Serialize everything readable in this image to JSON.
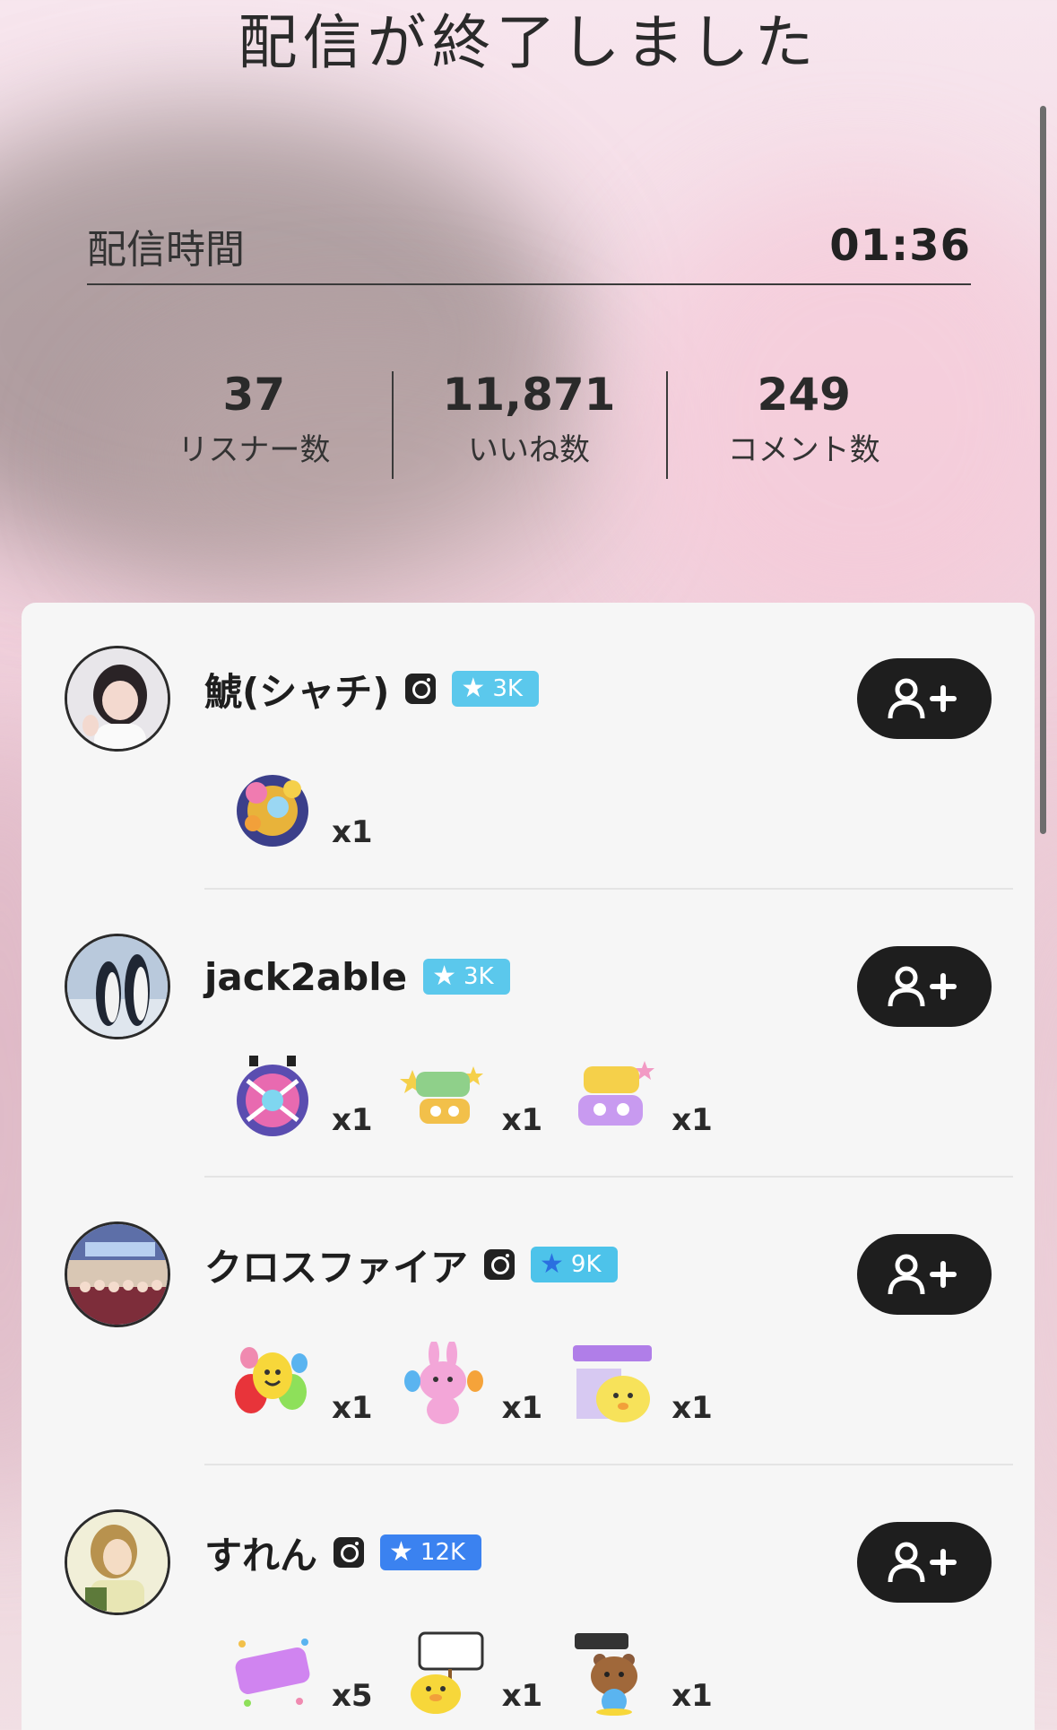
{
  "header": {
    "title": "配信が終了しました",
    "duration_label": "配信時間",
    "duration_value": "01:36"
  },
  "stats": [
    {
      "value": "37",
      "label": "リスナー数"
    },
    {
      "value": "11,871",
      "label": "いいね数"
    },
    {
      "value": "249",
      "label": "コメント数"
    }
  ],
  "users": [
    {
      "name": "鯱(シャチ)",
      "instagram": true,
      "badge": "3K",
      "badge_color": "#5bc8ec",
      "gifts": [
        {
          "icon": "fireworks-gift-icon",
          "count": "x1"
        }
      ]
    },
    {
      "name": "jack2able",
      "instagram": false,
      "badge": "3K",
      "badge_color": "#5bc8ec",
      "gifts": [
        {
          "icon": "disco-ball-gift-icon",
          "count": "x1"
        },
        {
          "icon": "eru-ome-sticker-icon",
          "count": "x1"
        },
        {
          "icon": "eru-ari-sticker-icon",
          "count": "x1"
        }
      ]
    },
    {
      "name": "クロスファイア",
      "instagram": true,
      "badge": "9K",
      "badge_color": "#4dc3ea",
      "gifts": [
        {
          "icon": "balloons-gift-icon",
          "count": "x1"
        },
        {
          "icon": "rabbit-maracas-sticker-icon",
          "count": "x1"
        },
        {
          "icon": "konbanwa-sticker-icon",
          "count": "x1"
        }
      ]
    },
    {
      "name": "すれん",
      "instagram": true,
      "badge": "12K",
      "badge_color": "#3b82f0",
      "gifts": [
        {
          "icon": "baburi-sticker-icon",
          "count": "x5"
        },
        {
          "icon": "tsugi-ittemiyo-sticker-icon",
          "count": "x1"
        },
        {
          "icon": "zekkouchou-sticker-icon",
          "count": "x1"
        }
      ]
    }
  ]
}
